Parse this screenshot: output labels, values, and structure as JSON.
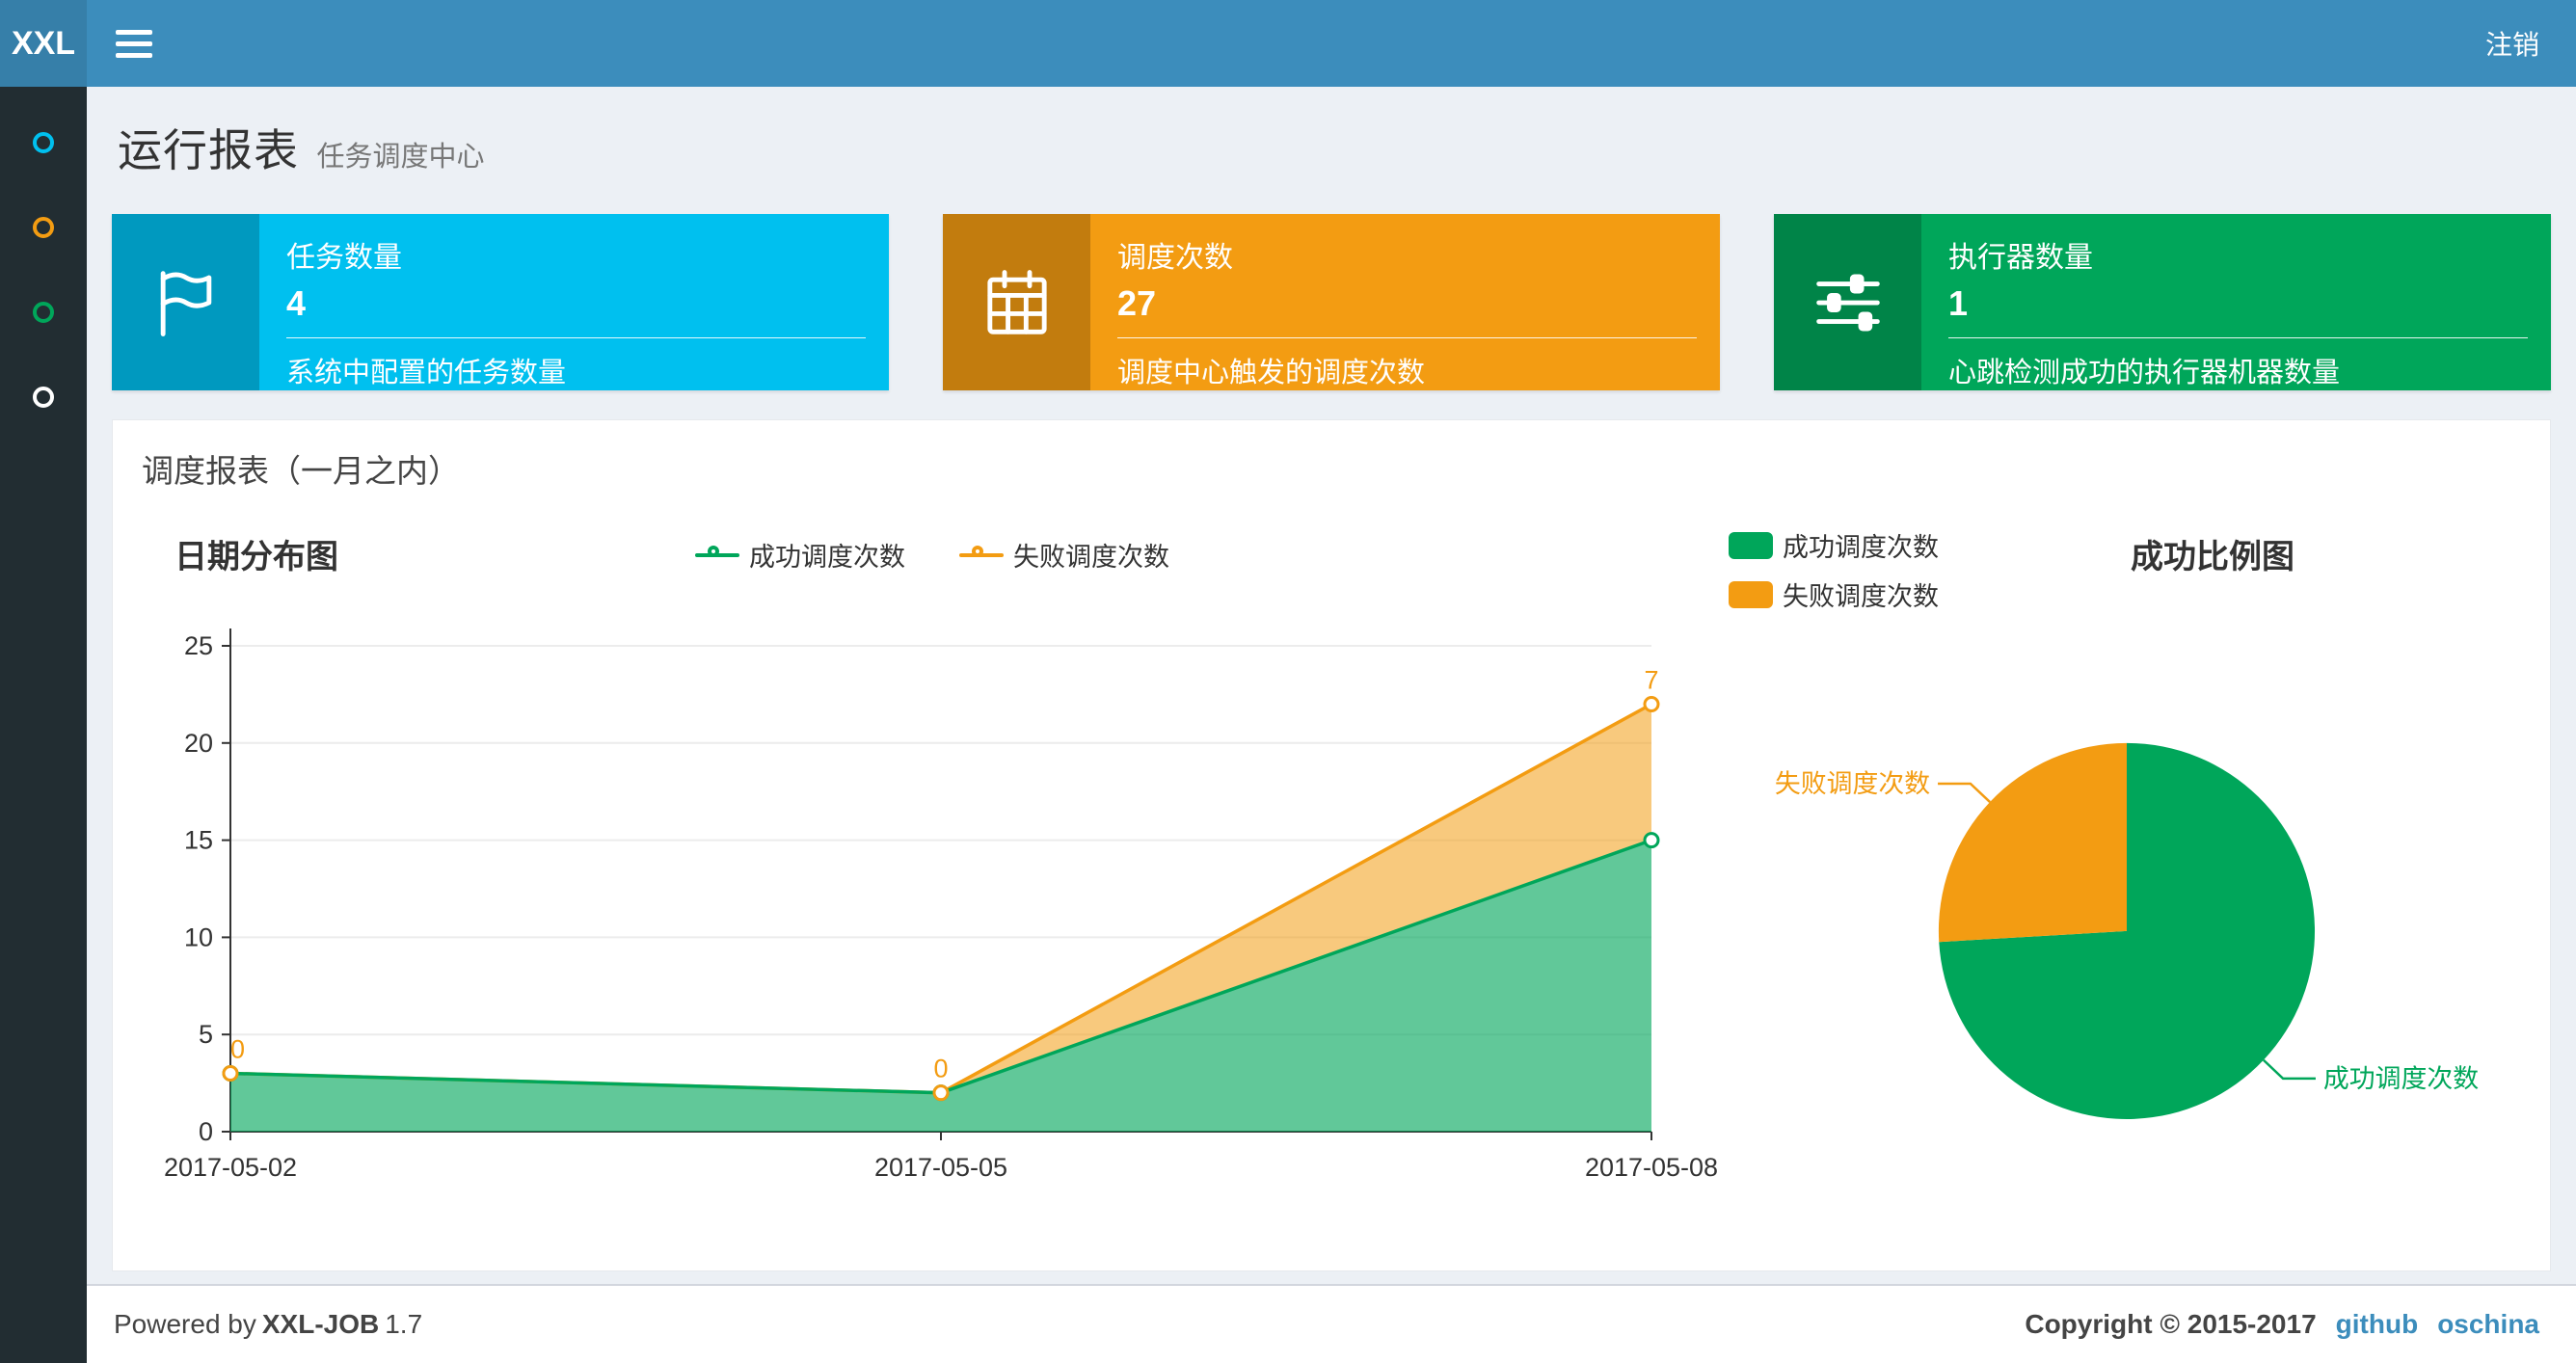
{
  "navbar": {
    "logo": "XXL",
    "logout": "注销"
  },
  "sidebar": {
    "items": [
      {
        "name": "dashboard",
        "color": "#00c0ef"
      },
      {
        "name": "job-manage",
        "color": "#f39c12"
      },
      {
        "name": "job-log",
        "color": "#00a65a"
      },
      {
        "name": "executor-manage",
        "color": "#ffffff"
      }
    ]
  },
  "header": {
    "title": "运行报表",
    "subtitle": "任务调度中心"
  },
  "info_boxes": [
    {
      "icon": "flag-icon",
      "label": "任务数量",
      "value": "4",
      "description": "系统中配置的任务数量",
      "color": "#00c0ef"
    },
    {
      "icon": "calendar-icon",
      "label": "调度次数",
      "value": "27",
      "description": "调度中心触发的调度次数",
      "color": "#f39c12"
    },
    {
      "icon": "sliders-icon",
      "label": "执行器数量",
      "value": "1",
      "description": "心跳检测成功的执行器机器数量",
      "color": "#00a65a"
    }
  ],
  "panel": {
    "title": "调度报表（一月之内）"
  },
  "chart_data": [
    {
      "type": "area",
      "title": "日期分布图",
      "x": [
        "2017-05-02",
        "2017-05-05",
        "2017-05-08"
      ],
      "series": [
        {
          "name": "成功调度次数",
          "values": [
            3,
            2,
            15
          ],
          "color": "#00a65a"
        },
        {
          "name": "失败调度次数",
          "values": [
            0,
            0,
            7
          ],
          "color": "#f39c12"
        }
      ],
      "stacked": true,
      "point_labels_series": 1,
      "ylim": [
        0,
        25
      ],
      "yticks": [
        0,
        5,
        10,
        15,
        20,
        25
      ],
      "grid": true,
      "legend_position": "top-center"
    },
    {
      "type": "pie",
      "title": "成功比例图",
      "slices": [
        {
          "name": "成功调度次数",
          "value": 20,
          "color": "#00a65a"
        },
        {
          "name": "失败调度次数",
          "value": 7,
          "color": "#f39c12"
        }
      ],
      "legend_position": "top-left"
    }
  ],
  "footer": {
    "powered_prefix": "Powered by",
    "brand": "XXL-JOB",
    "version": "1.7",
    "copyright": "Copyright © 2015-2017",
    "links": [
      "github",
      "oschina"
    ]
  }
}
